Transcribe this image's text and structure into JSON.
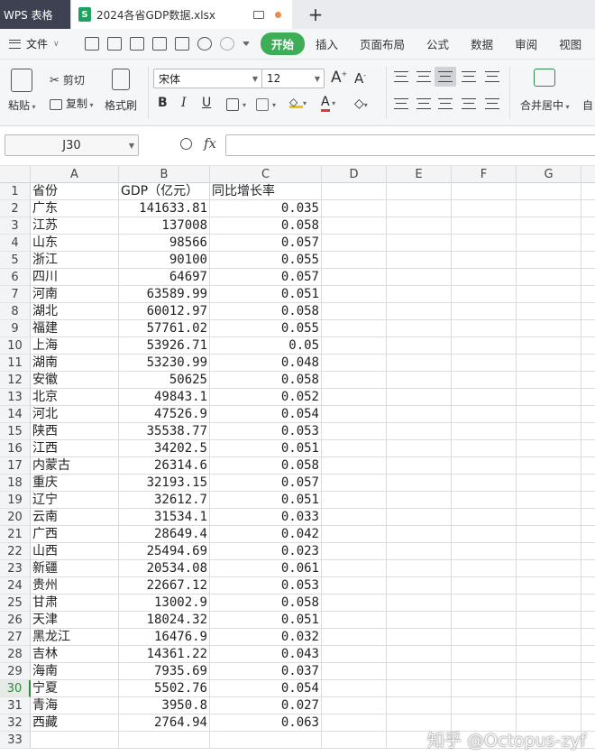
{
  "titlebar": {
    "app_name": "WPS 表格",
    "doc_title": "2024各省GDP数据.xlsx",
    "new_tab": "+"
  },
  "menubar": {
    "file_label": "文件",
    "tabs": [
      "开始",
      "插入",
      "页面布局",
      "公式",
      "数据",
      "审阅",
      "视图"
    ],
    "active_tab": "开始"
  },
  "ribbon": {
    "paste": "粘贴",
    "cut": "剪切",
    "copy": "复制",
    "format_painter": "格式刷",
    "font_name": "宋体",
    "font_size": "12",
    "merge_center": "合并居中",
    "auto_wrap": "自"
  },
  "formula_bar": {
    "name_box": "J30",
    "fx_label": "fx",
    "formula": ""
  },
  "sheet": {
    "columns": [
      "A",
      "B",
      "C",
      "D",
      "E",
      "F",
      "G"
    ],
    "active_row": 30,
    "header": [
      "省份",
      "GDP（亿元）",
      "同比增长率"
    ],
    "rows": [
      [
        "广东",
        "141633.81",
        "0.035"
      ],
      [
        "江苏",
        "137008",
        "0.058"
      ],
      [
        "山东",
        "98566",
        "0.057"
      ],
      [
        "浙江",
        "90100",
        "0.055"
      ],
      [
        "四川",
        "64697",
        "0.057"
      ],
      [
        "河南",
        "63589.99",
        "0.051"
      ],
      [
        "湖北",
        "60012.97",
        "0.058"
      ],
      [
        "福建",
        "57761.02",
        "0.055"
      ],
      [
        "上海",
        "53926.71",
        "0.05"
      ],
      [
        "湖南",
        "53230.99",
        "0.048"
      ],
      [
        "安徽",
        "50625",
        "0.058"
      ],
      [
        "北京",
        "49843.1",
        "0.052"
      ],
      [
        "河北",
        "47526.9",
        "0.054"
      ],
      [
        "陕西",
        "35538.77",
        "0.053"
      ],
      [
        "江西",
        "34202.5",
        "0.051"
      ],
      [
        "内蒙古",
        "26314.6",
        "0.058"
      ],
      [
        "重庆",
        "32193.15",
        "0.057"
      ],
      [
        "辽宁",
        "32612.7",
        "0.051"
      ],
      [
        "云南",
        "31534.1",
        "0.033"
      ],
      [
        "广西",
        "28649.4",
        "0.042"
      ],
      [
        "山西",
        "25494.69",
        "0.023"
      ],
      [
        "新疆",
        "20534.08",
        "0.061"
      ],
      [
        "贵州",
        "22667.12",
        "0.053"
      ],
      [
        "甘肃",
        "13002.9",
        "0.058"
      ],
      [
        "天津",
        "18024.32",
        "0.051"
      ],
      [
        "黑龙江",
        "16476.9",
        "0.032"
      ],
      [
        "吉林",
        "14361.22",
        "0.043"
      ],
      [
        "海南",
        "7935.69",
        "0.037"
      ],
      [
        "宁夏",
        "5502.76",
        "0.054"
      ],
      [
        "青海",
        "3950.8",
        "0.027"
      ],
      [
        "西藏",
        "2764.94",
        "0.063"
      ]
    ]
  },
  "watermark": "知乎 @Octopus-zyf",
  "colors": {
    "accent_green": "#3dae57",
    "app_tab_bg": "#3c4251",
    "doc_icon": "#1ba45c",
    "active_row": "#2d8a3e"
  }
}
